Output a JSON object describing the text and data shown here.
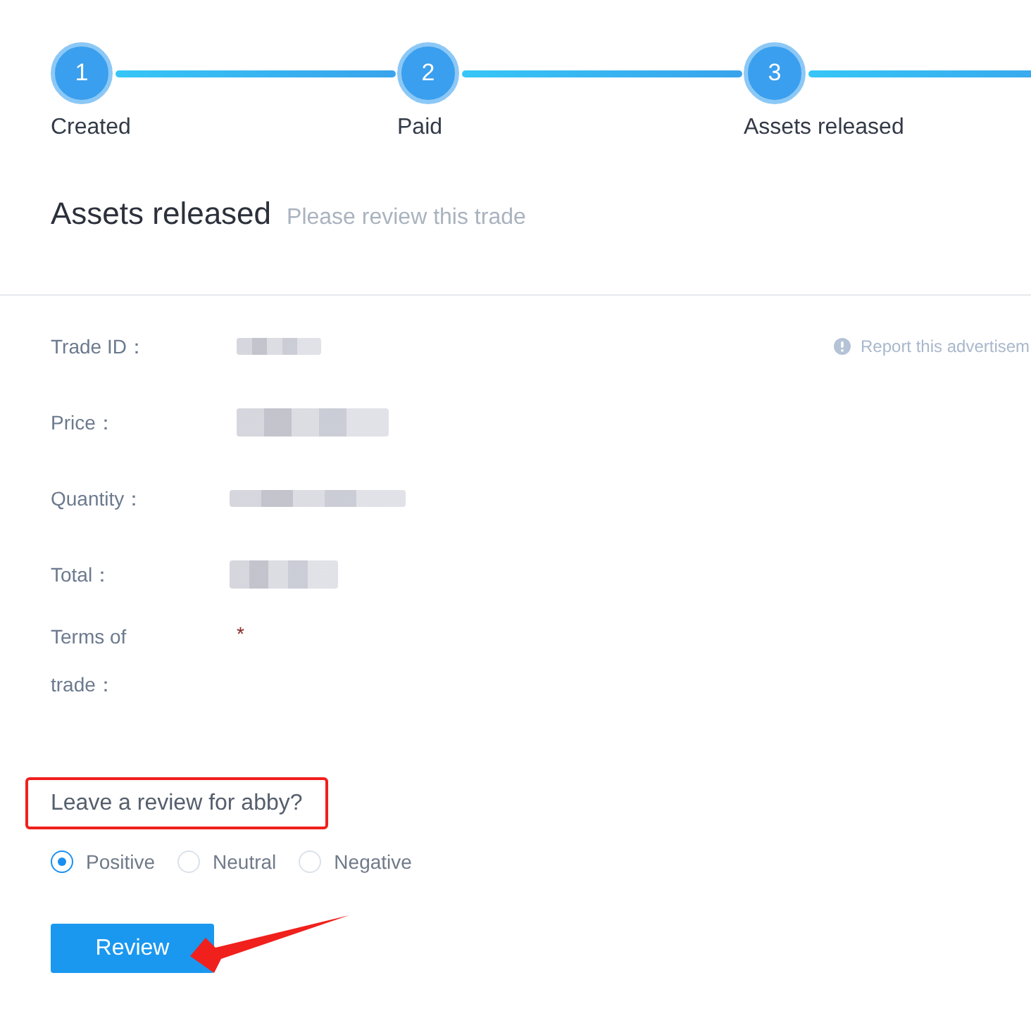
{
  "steps": [
    {
      "number": "1",
      "label": "Created"
    },
    {
      "number": "2",
      "label": "Paid"
    },
    {
      "number": "3",
      "label": "Assets released"
    }
  ],
  "header": {
    "title": "Assets released",
    "subtitle": "Please review this trade"
  },
  "report_link": "Report this advertisem",
  "details": [
    {
      "label": "Trade ID：",
      "kind": "blurred"
    },
    {
      "label": "Price：",
      "kind": "blurred"
    },
    {
      "label": "Quantity：",
      "kind": "blurred"
    },
    {
      "label": "Total：",
      "kind": "blurred"
    },
    {
      "label": "Terms of trade：",
      "kind": "text",
      "value": "*"
    }
  ],
  "review": {
    "prompt": "Leave a review for abby?",
    "options": [
      {
        "label": "Positive",
        "selected": true
      },
      {
        "label": "Neutral",
        "selected": false
      },
      {
        "label": "Negative",
        "selected": false
      }
    ],
    "button": "Review"
  },
  "annotations": {
    "prompt_frame": true,
    "arrow_to_button": true
  }
}
